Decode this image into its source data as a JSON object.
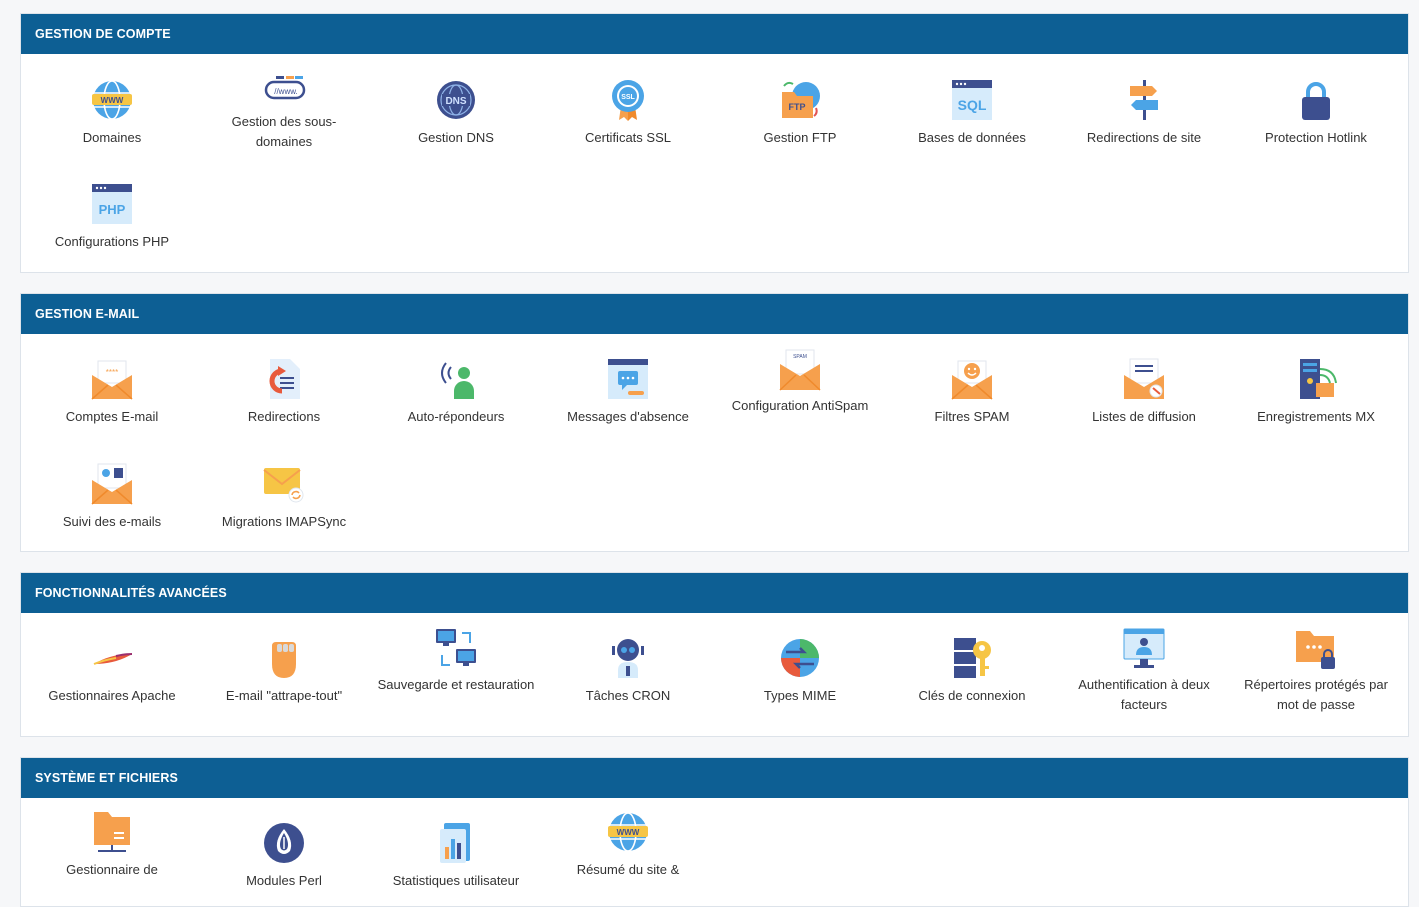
{
  "sections": [
    {
      "title": "GESTION DE COMPTE",
      "items": [
        {
          "label": "Domaines",
          "icon": "globe-www-icon"
        },
        {
          "label": "Gestion des sous-domaines",
          "icon": "subdomain-www-icon"
        },
        {
          "label": "Gestion DNS",
          "icon": "dns-globe-icon"
        },
        {
          "label": "Certificats SSL",
          "icon": "ssl-badge-icon"
        },
        {
          "label": "Gestion FTP",
          "icon": "ftp-folder-icon"
        },
        {
          "label": "Bases de données",
          "icon": "sql-database-icon"
        },
        {
          "label": "Redirections de site",
          "icon": "signpost-icon"
        },
        {
          "label": "Protection Hotlink",
          "icon": "lock-icon"
        },
        {
          "label": "Configurations PHP",
          "icon": "php-window-icon"
        }
      ]
    },
    {
      "title": "GESTION E-MAIL",
      "items": [
        {
          "label": "Comptes E-mail",
          "icon": "email-account-icon"
        },
        {
          "label": "Redirections",
          "icon": "email-forward-icon"
        },
        {
          "label": "Auto-répondeurs",
          "icon": "auto-responder-icon"
        },
        {
          "label": "Messages d'absence",
          "icon": "absence-message-icon"
        },
        {
          "label": "Configuration AntiSpam",
          "icon": "antispam-envelope-icon"
        },
        {
          "label": "Filtres SPAM",
          "icon": "spam-filter-envelope-icon"
        },
        {
          "label": "Listes de diffusion",
          "icon": "mailing-list-icon"
        },
        {
          "label": "Enregistrements MX",
          "icon": "mx-server-icon"
        },
        {
          "label": "Suivi des e-mails",
          "icon": "email-tracking-icon"
        },
        {
          "label": "Migrations IMAPSync",
          "icon": "imapsync-envelope-icon"
        }
      ]
    },
    {
      "title": "FONCTIONNALITÉS AVANCÉES",
      "items": [
        {
          "label": "Gestionnaires Apache",
          "icon": "apache-feather-icon"
        },
        {
          "label": "E-mail \"attrape-tout\"",
          "icon": "catch-all-hand-icon"
        },
        {
          "label": "Sauvegarde et restauration",
          "icon": "backup-computers-icon"
        },
        {
          "label": "Tâches CRON",
          "icon": "cron-robot-icon"
        },
        {
          "label": "Types MIME",
          "icon": "mime-types-icon"
        },
        {
          "label": "Clés de connexion",
          "icon": "login-keys-icon"
        },
        {
          "label": "Authentification à deux facteurs",
          "icon": "two-factor-auth-icon"
        },
        {
          "label": "Répertoires protégés par mot de passe",
          "icon": "protected-folder-icon"
        }
      ]
    },
    {
      "title": "SYSTÈME ET FICHIERS",
      "items": [
        {
          "label": "Gestionnaire de",
          "icon": "file-manager-folder-icon"
        },
        {
          "label": "Modules Perl",
          "icon": "perl-onion-icon"
        },
        {
          "label": "Statistiques utilisateur",
          "icon": "user-stats-icon"
        },
        {
          "label": "Résumé du site &",
          "icon": "site-summary-globe-icon"
        }
      ]
    }
  ],
  "colors": {
    "header_bg": "#0d5f94",
    "orange": "#f6a04d",
    "blue": "#4b9fe0",
    "navy": "#3d4f8f",
    "yellow": "#f6c545"
  }
}
